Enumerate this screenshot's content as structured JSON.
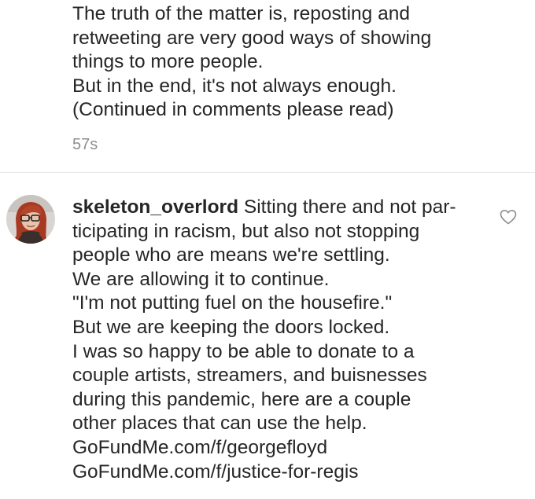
{
  "first_comment": {
    "lines": [
      "The truth of the matter is, reposting and",
      "retweeting are very good ways of showing",
      "things to more people.",
      "But in the end, it's not always enough.",
      "(Continued in comments please read)"
    ],
    "timestamp": "57s"
  },
  "second_comment": {
    "avatar_icon": "user-avatar-red-hair-glasses",
    "username": "skeleton_overlord",
    "first_line_text": " Sitting there and not par-",
    "lines": [
      "ticipating in racism, but also not stopping",
      "people who are means we're settling.",
      "We are allowing it to continue.",
      "\"I'm not putting fuel on the housefire.\"",
      "But we are keeping the doors locked.",
      "I was so happy to be able to donate to a",
      "couple artists, streamers, and buisnesses",
      "during this pandemic, here are a couple",
      "other places that can use the help.",
      "GoFundMe.com/f/georgefloyd",
      "GoFundMe.com/f/justice-for-regis"
    ],
    "like_icon": "heart-outline-icon"
  },
  "colors": {
    "text": "#262626",
    "secondary_text": "#8e8e8e",
    "divider": "#e8e8e8",
    "background": "#ffffff"
  }
}
